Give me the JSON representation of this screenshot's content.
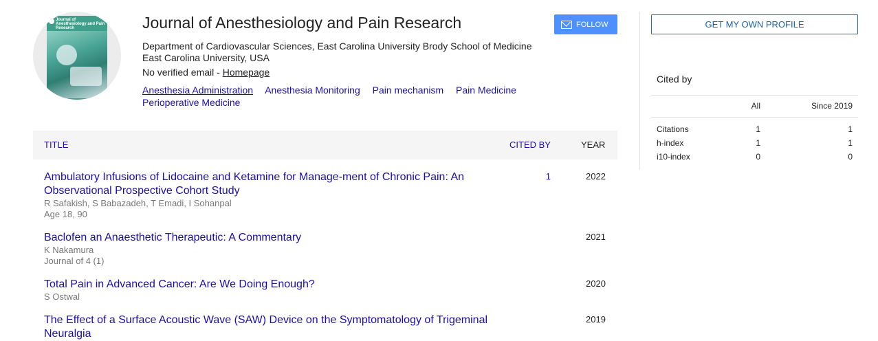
{
  "profile": {
    "cover_title": "Journal of Anesthesiology and Pain Research",
    "name": "Journal of Anesthesiology and Pain Research",
    "affiliation": "Department of Cardiovascular Sciences, East Carolina University Brody School of Medicine East Carolina University, USA",
    "email_text": "No verified email - ",
    "homepage_label": "Homepage",
    "interests": [
      "Anesthesia Administration",
      "Anesthesia Monitoring",
      "Pain mechanism",
      "Pain Medicine",
      "Perioperative Medicine"
    ]
  },
  "buttons": {
    "follow_label": "FOLLOW",
    "profile_label": "GET MY OWN PROFILE"
  },
  "table": {
    "headers": {
      "title": "TITLE",
      "cited_by": "CITED BY",
      "year": "YEAR"
    },
    "rows": [
      {
        "title": "Ambulatory Infusions of Lidocaine and Ketamine for Manage-ment of Chronic Pain: An Observational Prospective Cohort Study",
        "authors": "R Safakish, S Babazadeh, T Emadi, I Sohanpal",
        "venue": "Age 18, 90",
        "cited": "1",
        "year": "2022"
      },
      {
        "title": "Baclofen an Anaesthetic Therapeutic: A Commentary",
        "authors": "K Nakamura",
        "venue": "Journal of 4 (1)",
        "cited": "",
        "year": "2021"
      },
      {
        "title": "Total Pain in Advanced Cancer: Are We Doing Enough?",
        "authors": "S Ostwal",
        "venue": "",
        "cited": "",
        "year": "2020"
      },
      {
        "title": "The Effect of a Surface Acoustic Wave (SAW) Device on the Symptomatology of Trigeminal Neuralgia",
        "authors": "",
        "venue": "",
        "cited": "",
        "year": "2019"
      }
    ]
  },
  "cited_by": {
    "label": "Cited by",
    "col_all": "All",
    "col_since": "Since 2019",
    "rows": [
      {
        "label": "Citations",
        "all": "1",
        "since": "1"
      },
      {
        "label": "h-index",
        "all": "1",
        "since": "1"
      },
      {
        "label": "i10-index",
        "all": "0",
        "since": "0"
      }
    ]
  },
  "colors": {
    "link": "#1a0dab",
    "follow_button": "#4d90fe",
    "header_bg": "#f5f5f5"
  },
  "icons": {
    "follow": "mail-plus-icon"
  }
}
